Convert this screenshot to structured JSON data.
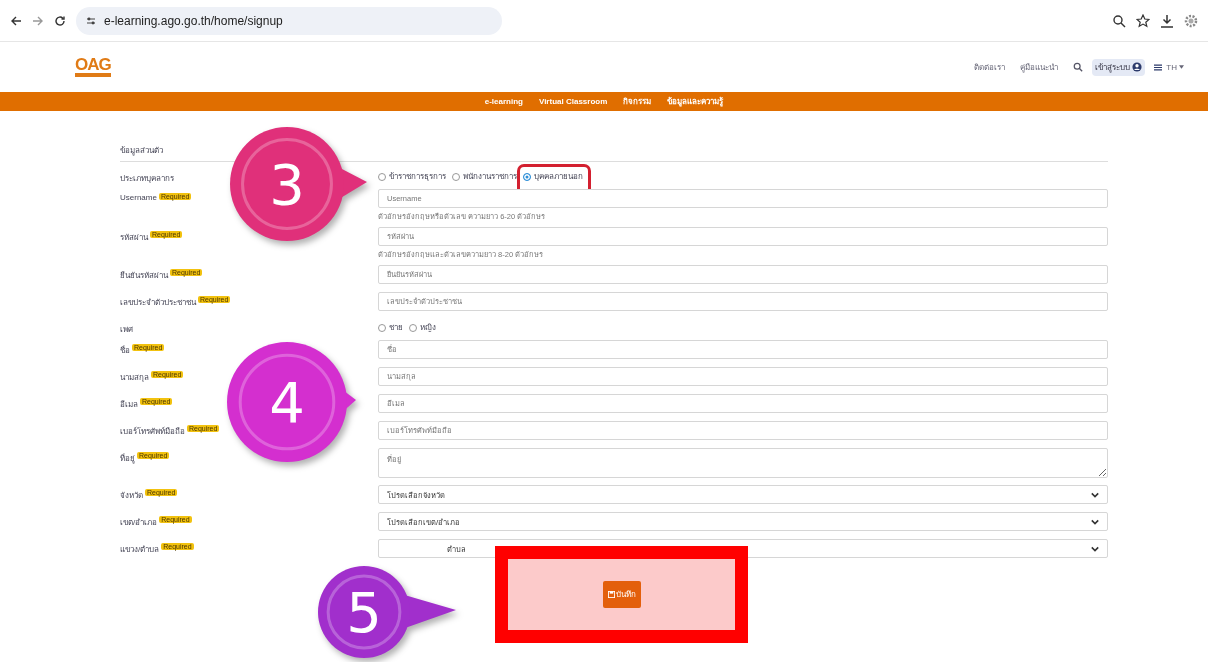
{
  "browser": {
    "url": "e-learning.ago.go.th/home/signup"
  },
  "header": {
    "logo": "OAG",
    "links": [
      "ติดต่อเรา",
      "คู่มือแนะนำ"
    ],
    "login_button": "เข้าสู่ระบบ",
    "language": "TH"
  },
  "nav": [
    "e-learning",
    "Virtual Classroom",
    "กิจกรรม",
    "ข้อมูลและความรู้"
  ],
  "section_title": "ข้อมูลส่วนตัว",
  "fields": [
    {
      "kind": "radio",
      "label": "ประเภทบุคลากร",
      "options": [
        {
          "label": "ข้าราชการธุรการ",
          "selected": false
        },
        {
          "label": "พนักงานราชการ",
          "selected": false
        },
        {
          "label": "บุคคลภายนอก",
          "selected": true
        }
      ]
    },
    {
      "kind": "text",
      "label": "Username",
      "badge": "Required",
      "placeholder": "Username",
      "hint": "ตัวอักษรอังกฤษหรือตัวเลข ความยาว 6-20 ตัวอักษร"
    },
    {
      "kind": "text",
      "label": "รหัสผ่าน",
      "badge": "Required",
      "placeholder": "รหัสผ่าน",
      "hint": "ตัวอักษรอังกฤษและตัวเลขความยาว 8-20 ตัวอักษร"
    },
    {
      "kind": "text",
      "label": "ยืนยันรหัสผ่าน",
      "badge": "Required",
      "placeholder": "ยืนยันรหัสผ่าน"
    },
    {
      "kind": "text",
      "label": "เลขประจำตัวประชาชน",
      "badge": "Required",
      "placeholder": "เลขประจำตัวประชาชน"
    },
    {
      "kind": "radio",
      "label": "เพศ",
      "options": [
        {
          "label": "ชาย",
          "selected": false
        },
        {
          "label": "หญิง",
          "selected": false
        }
      ]
    },
    {
      "kind": "text",
      "label": "ชื่อ",
      "badge": "Required",
      "placeholder": "ชื่อ"
    },
    {
      "kind": "text",
      "label": "นามสกุล",
      "badge": "Required",
      "placeholder": "นามสกุล"
    },
    {
      "kind": "text",
      "label": "อีเมล",
      "badge": "Required",
      "placeholder": "อีเมล"
    },
    {
      "kind": "text",
      "label": "เบอร์โทรศัพท์มือถือ",
      "badge": "Required",
      "placeholder": "เบอร์โทรศัพท์มือถือ"
    },
    {
      "kind": "textarea",
      "label": "ที่อยู่",
      "badge": "Required",
      "placeholder": "ที่อยู่"
    },
    {
      "kind": "select",
      "label": "จังหวัด",
      "badge": "Required",
      "value": "โปรดเลือกจังหวัด"
    },
    {
      "kind": "select",
      "label": "เขต/อำเภอ",
      "badge": "Required",
      "value": "โปรดเลือกเขต/อำเภอ"
    },
    {
      "kind": "select",
      "label": "แขวง/ตำบล",
      "badge": "Required",
      "value": "ตำบล"
    }
  ],
  "submit_button": "บันทึก",
  "callouts": [
    {
      "number": "3",
      "color": "#e0307a"
    },
    {
      "number": "4",
      "color": "#d42fcf"
    },
    {
      "number": "5",
      "color": "#a12fcc"
    }
  ]
}
